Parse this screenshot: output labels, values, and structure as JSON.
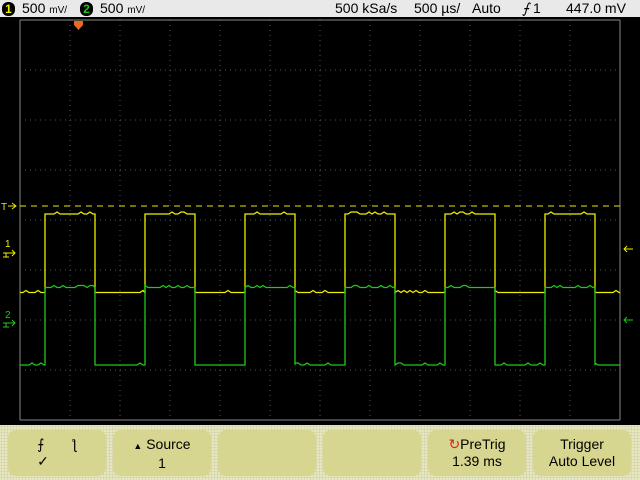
{
  "header": {
    "ch1": {
      "number": "1",
      "scale": "500",
      "unit": "mV/",
      "color": "#f0f000"
    },
    "ch2": {
      "number": "2",
      "scale": "500",
      "unit": "mV/",
      "color": "#1ec81e"
    },
    "sample_rate": "500 kSa/s",
    "timebase": "500 µs/",
    "trigger_mode": "Auto",
    "trigger_slope_icon": "rising-edge-icon",
    "trigger_source": "1",
    "trigger_level": "447.0 mV"
  },
  "display": {
    "ch1_marker": "1",
    "ch2_marker": "2",
    "trigger_marker": "T",
    "waveforms": {
      "period_ms": 1.0,
      "duty": 0.5,
      "ms_per_div": 0.5,
      "ch1_high_div": 4.12,
      "ch1_low_div": 2.55,
      "ch2_high_div": 2.65,
      "ch2_low_div": 1.1
    }
  },
  "softkeys": {
    "slope": {
      "rising": "⨍",
      "falling": "ƪ",
      "check": "✓"
    },
    "source": {
      "label": "Source",
      "value": "1"
    },
    "pretrig": {
      "label": "PreTrig",
      "value": "1.39 ms"
    },
    "trigger": {
      "label": "Trigger",
      "value": "Auto Level"
    }
  }
}
